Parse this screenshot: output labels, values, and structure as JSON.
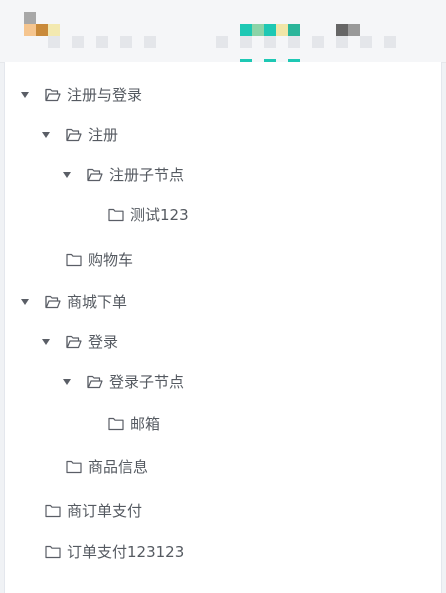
{
  "header": {
    "blurred_colors": [
      "#a8a8a8",
      "#f5c58f",
      "#c98a3a",
      "#f3e9b0",
      "#1ec8b4",
      "#8cd4a8",
      "#f1e6a8",
      "#2bb59a",
      "#666666",
      "#999999",
      "#e4e6ea"
    ]
  },
  "tree": {
    "nodes": [
      {
        "label": "注册与登录",
        "expanded": true,
        "level": 0,
        "open_folder": true
      },
      {
        "label": "注册",
        "expanded": true,
        "level": 1,
        "open_folder": true
      },
      {
        "label": "注册子节点",
        "expanded": true,
        "level": 2,
        "open_folder": true
      },
      {
        "label": "测试123",
        "expanded": false,
        "level": 3,
        "open_folder": false
      },
      {
        "label": "购物车",
        "expanded": false,
        "level": 1,
        "open_folder": false
      },
      {
        "label": "商城下单",
        "expanded": true,
        "level": 0,
        "open_folder": true
      },
      {
        "label": "登录",
        "expanded": true,
        "level": 1,
        "open_folder": true
      },
      {
        "label": "登录子节点",
        "expanded": true,
        "level": 2,
        "open_folder": true
      },
      {
        "label": "邮箱",
        "expanded": false,
        "level": 3,
        "open_folder": false
      },
      {
        "label": "商品信息",
        "expanded": false,
        "level": 1,
        "open_folder": false
      },
      {
        "label": "商订单支付",
        "expanded": false,
        "level": 0,
        "open_folder": false
      },
      {
        "label": "订单支付123123",
        "expanded": false,
        "level": 0,
        "open_folder": false
      }
    ]
  },
  "icons": {
    "caret": "caret-down-icon",
    "folder_open": "folder-open-icon",
    "folder_closed": "folder-icon"
  }
}
